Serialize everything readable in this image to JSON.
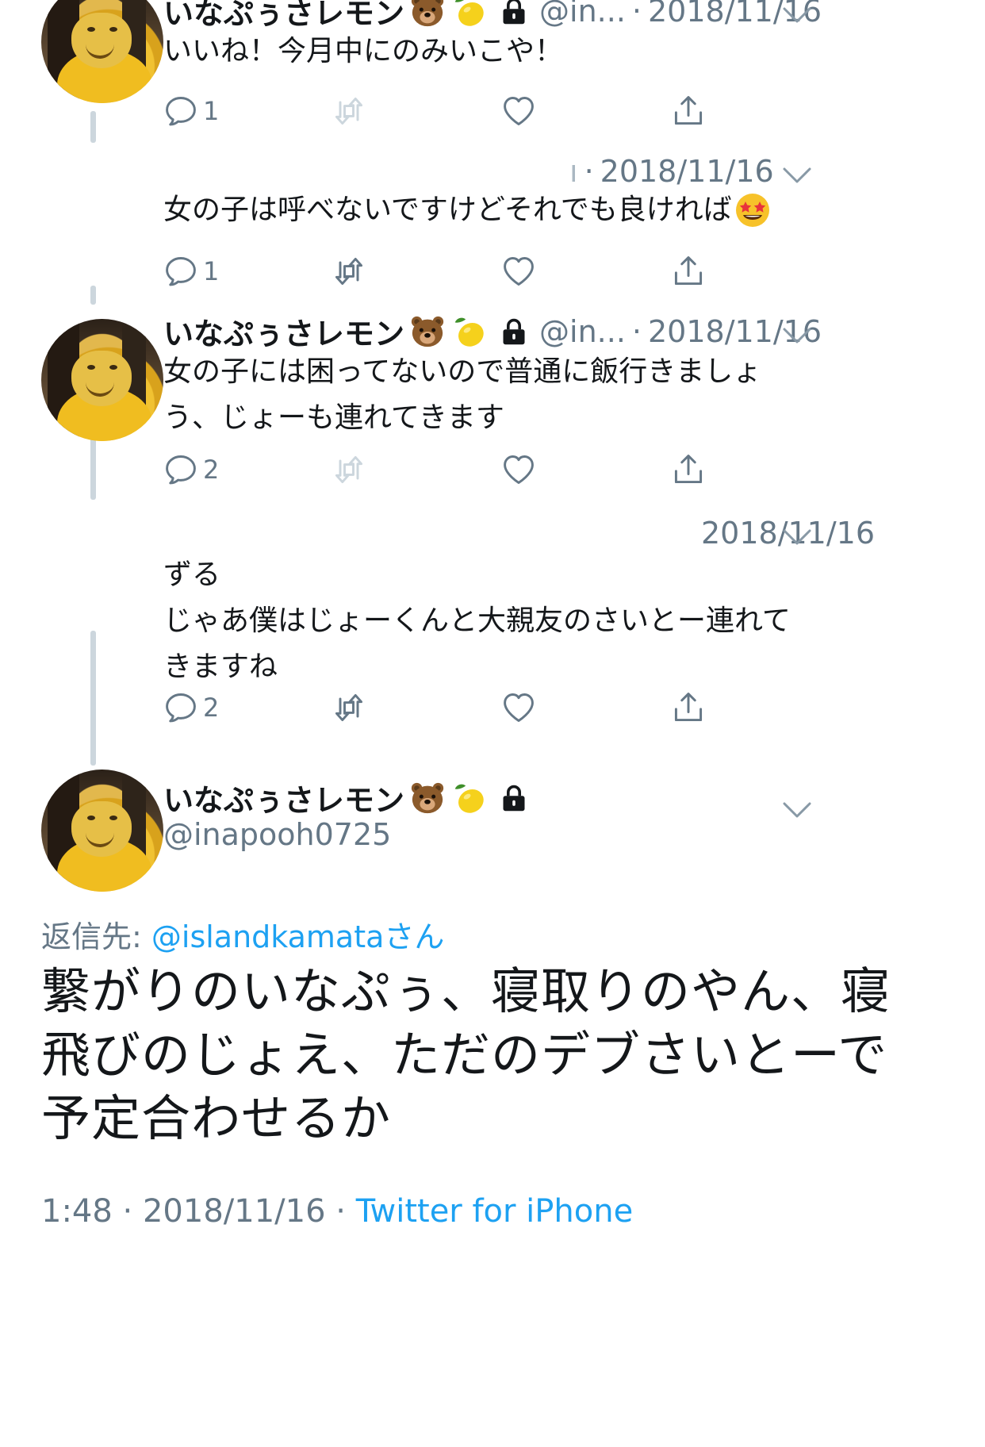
{
  "thread": [
    {
      "author_name": "いなぷぅさレモン",
      "handle": "@in...",
      "sep": "·",
      "date": "2018/11/16",
      "text": "いいね！今月中にのみいこや！",
      "reply_count": "1",
      "retweet_count": "",
      "like_count": "",
      "retweet_enabled": false
    },
    {
      "author_name": "",
      "handle": "ı",
      "sep": "·",
      "date": "2018/11/16",
      "text": "女の子は呼べないですけどそれでも良ければ",
      "reply_count": "1",
      "retweet_count": "",
      "like_count": "",
      "retweet_enabled": true
    },
    {
      "author_name": "いなぷぅさレモン",
      "handle": "@in...",
      "sep": "·",
      "date": "2018/11/16",
      "text_line1": "女の子には困ってないので普通に飯行きましょ",
      "text_line2": "う、じょーも連れてきます",
      "reply_count": "2",
      "retweet_count": "",
      "like_count": "",
      "retweet_enabled": false
    },
    {
      "author_name": "",
      "handle": "",
      "date": "2018/11/16",
      "text_line1": "ずる",
      "text_line2": "じゃあ僕はじょーくんと大親友のさいとー連れて",
      "text_line3": "きますね",
      "reply_count": "2",
      "retweet_count": "",
      "like_count": "",
      "retweet_enabled": true
    }
  ],
  "main_tweet": {
    "author_name": "いなぷぅさレモン",
    "handle": "@inapooh0725",
    "reply_to_prefix": "返信先: ",
    "reply_to_user": "@islandkamataさん",
    "text_line1": "繋がりのいなぷぅ、寝取りのやん、寝",
    "text_line2": "飛びのじょえ、ただのデブさいとーで",
    "text_line3": "予定合わせるか",
    "time": "1:48",
    "sep": "·",
    "date": "2018/11/16",
    "sep2": "·",
    "client": "Twitter for iPhone"
  },
  "icons": {
    "reply": "reply-icon",
    "retweet": "retweet-icon",
    "like": "heart-icon",
    "share": "share-icon",
    "more": "chevron-down-icon",
    "lock": "lock-icon",
    "bear": "bear-emoji",
    "lemon": "lemon-emoji",
    "star_struck": "star-struck-emoji"
  },
  "colors": {
    "text": "#14171a",
    "secondary": "#657786",
    "link": "#1da1f2",
    "thread_line": "#ccd6dd",
    "disabled_icon": "#ccd6dd"
  }
}
